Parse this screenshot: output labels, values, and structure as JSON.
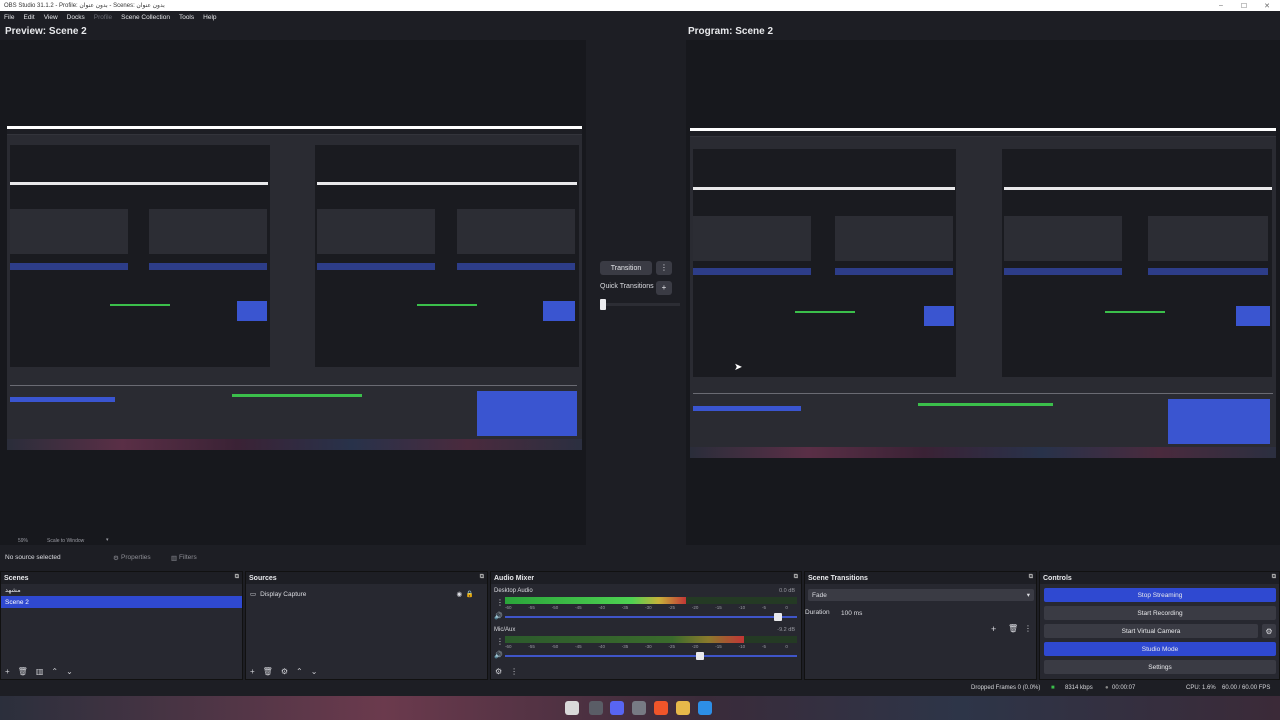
{
  "window": {
    "title": "OBS Studio 31.1.2 - Profile: بدون عنوان - Scenes: بدون عنوان",
    "controls": [
      "–",
      "☐",
      "✕"
    ]
  },
  "menu": [
    "File",
    "Edit",
    "View",
    "Docks",
    "Profile",
    "Scene Collection",
    "Tools",
    "Help"
  ],
  "preview": {
    "title": "Preview: Scene 2",
    "zoom": "59%",
    "scale_mode": "Scale to Window"
  },
  "program": {
    "title": "Program: Scene 2"
  },
  "transition_panel": {
    "transition_label": "Transition",
    "quick_transitions_label": "Quick Transitions"
  },
  "source_toolbar": {
    "status": "No source selected",
    "properties_label": "Properties",
    "filters_label": "Filters"
  },
  "scenes": {
    "title": "Scenes",
    "items": [
      {
        "label": "مشهد",
        "selected": false
      },
      {
        "label": "Scene 2",
        "selected": true
      }
    ]
  },
  "sources": {
    "title": "Sources",
    "items": [
      {
        "label": "Display Capture"
      }
    ]
  },
  "audio_mixer": {
    "title": "Audio Mixer",
    "channels": [
      {
        "name": "Desktop Audio",
        "level_db": "0.0 dB",
        "scale": [
          "-60",
          "-55",
          "-50",
          "-45",
          "-40",
          "-35",
          "-30",
          "-25",
          "-20",
          "-15",
          "-10",
          "-5",
          "0"
        ],
        "volume": 0.95,
        "meter": 0.62
      },
      {
        "name": "Mic/Aux",
        "level_db": "-9.2 dB",
        "scale": [
          "-60",
          "-55",
          "-50",
          "-45",
          "-40",
          "-35",
          "-30",
          "-25",
          "-20",
          "-15",
          "-10",
          "-5",
          "0"
        ],
        "volume": 0.68,
        "meter": 0.82
      }
    ]
  },
  "scene_transitions": {
    "title": "Scene Transitions",
    "selected": "Fade",
    "duration_label": "Duration",
    "duration_value": "100 ms"
  },
  "controls": {
    "title": "Controls",
    "stop_streaming": "Stop Streaming",
    "start_recording": "Start Recording",
    "start_virtual_camera": "Start Virtual Camera",
    "studio_mode": "Studio Mode",
    "settings": "Settings"
  },
  "status": {
    "dropped_frames": "Dropped Frames 0 (0.0%)",
    "bitrate": "8314 kbps",
    "time": "00:00:07",
    "cpu": "CPU: 1.6%",
    "fps": "60.00 / 60.00 FPS"
  },
  "taskbar_icons": [
    "obs-icon",
    "settings-gear-icon",
    "discord-icon",
    "gear-icon",
    "brave-icon",
    "folder-icon",
    "windows-icon"
  ],
  "colors": {
    "accent": "#2f49d1",
    "background": "#1d1e24",
    "panel": "#272830"
  }
}
